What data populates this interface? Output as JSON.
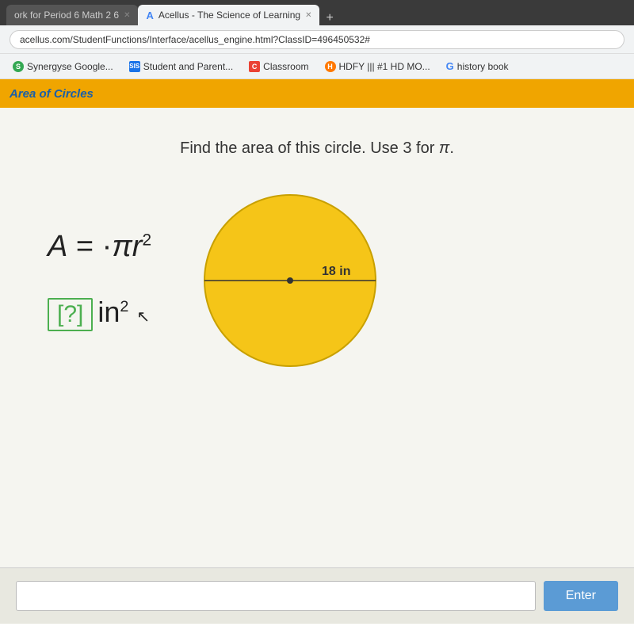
{
  "browser": {
    "tabs": [
      {
        "id": "tab1",
        "label": "ork for Period 6 Math 2 6",
        "active": false
      },
      {
        "id": "tab2",
        "label": "Acellus - The Science of Learning",
        "active": true
      },
      {
        "id": "tab3",
        "label": "+",
        "active": false
      }
    ],
    "address": "acellus.com/StudentFunctions/Interface/acellus_engine.html?ClassID=496450532#"
  },
  "bookmarks": [
    {
      "id": "bk1",
      "label": "Synergyse Google...",
      "icon_type": "green-circle",
      "icon_text": "S"
    },
    {
      "id": "bk2",
      "label": "Student and Parent...",
      "icon_type": "blue-square",
      "icon_text": "SIS"
    },
    {
      "id": "bk3",
      "label": "Classroom",
      "icon_type": "red-square",
      "icon_text": "C"
    },
    {
      "id": "bk4",
      "label": "HDFY ||| #1 HD MO...",
      "icon_type": "orange-circle",
      "icon_text": "H"
    },
    {
      "id": "bk5",
      "label": "history book",
      "icon_type": "google-g",
      "icon_text": "G"
    }
  ],
  "page": {
    "header_title": "Area of Circles",
    "problem_text": "Find the area of this circle. Use 3 for π.",
    "formula_label": "A = πr²",
    "answer_placeholder": "[?] in²",
    "bracket_text": "[?]",
    "unit_text": "in²",
    "circle": {
      "radius_label": "18 in",
      "fill_color": "#f5c518",
      "stroke_color": "#d4a000"
    },
    "input_placeholder": "",
    "enter_button_label": "Enter"
  }
}
